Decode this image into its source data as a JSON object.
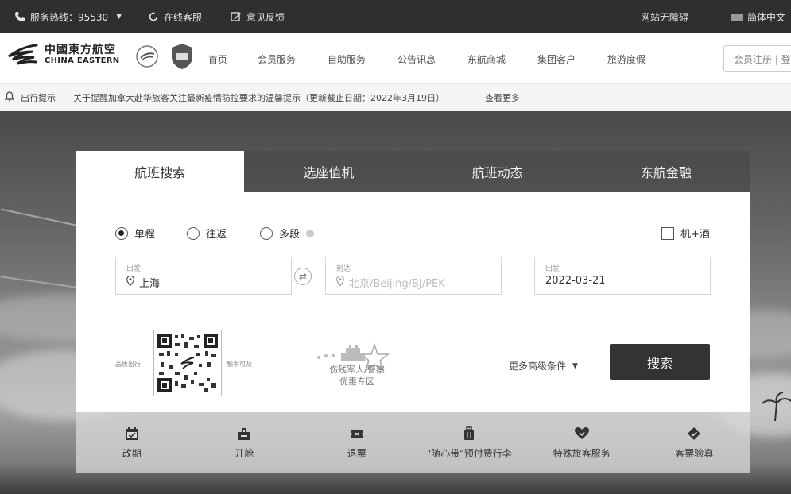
{
  "topbar": {
    "hotline": "服务热线：95530",
    "online_service": "在线客服",
    "feedback": "意见反馈",
    "accessibility": "网站无障碍",
    "language": "简体中文"
  },
  "header": {
    "logo_cn": "中國東方航空",
    "logo_en": "CHINA EASTERN",
    "nav": [
      "首页",
      "会员服务",
      "自助服务",
      "公告讯息",
      "东航商城",
      "集团客户",
      "旅游度假"
    ],
    "login": "会员注册 | 登录"
  },
  "notice": {
    "label": "出行提示",
    "text": "关于提醒加拿大赴华旅客关注最新疫情防控要求的温馨提示（更新截止日期：2022年3月19日）",
    "more": "查看更多"
  },
  "tabs": [
    "航班搜索",
    "选座值机",
    "航班动态",
    "东航金融"
  ],
  "trip_types": [
    "单程",
    "往返",
    "多段"
  ],
  "hotel_option": "机+酒",
  "form": {
    "from_label": "出发",
    "from_value": "上海",
    "to_label": "到达",
    "to_placeholder": "北京/Beijing/BJ/PEK",
    "date_label": "出发",
    "date_value": "2022-03-21"
  },
  "promo": {
    "qr_left": "品质出行",
    "qr_right": "触手可及",
    "military_line1": "伤残军人/警察",
    "military_line2": "优惠专区"
  },
  "more_conditions": "更多高级条件",
  "search_button": "搜索",
  "services": [
    "改期",
    "开舱",
    "退票",
    "\"随心带\"预付费行李",
    "特殊旅客服务",
    "客票验真"
  ],
  "colors": {
    "topbar_bg": "#2f2f2f",
    "search_button_bg": "#333333"
  }
}
